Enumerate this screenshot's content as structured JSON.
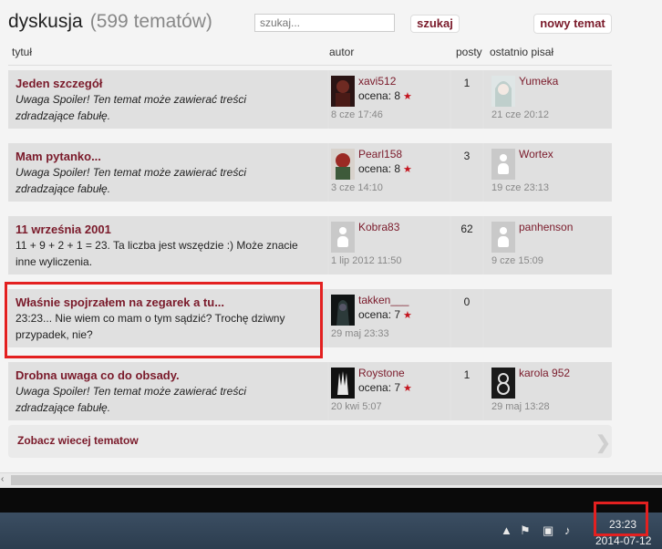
{
  "header": {
    "title": "dyskusja",
    "count": "(599 tematów)",
    "search_placeholder": "szukaj...",
    "search_button": "szukaj",
    "new_topic_button": "nowy temat"
  },
  "columns": {
    "title": "tytuł",
    "author": "autor",
    "posts": "posty",
    "last": "ostatnio pisał"
  },
  "topics": [
    {
      "title": "Jeden szczegół",
      "desc": "Uwaga Spoiler! Ten temat może zawierać treści zdradzające fabułę.",
      "author": "xavi512",
      "author_rating": "ocena: 8",
      "author_date": "8 cze 17:46",
      "posts": "1",
      "last_user": "Yumeka",
      "last_date": "21 cze 20:12"
    },
    {
      "title": "Mam pytanko...",
      "desc": "Uwaga Spoiler! Ten temat może zawierać treści zdradzające fabułę.",
      "author": "Pearl158",
      "author_rating": "ocena: 8",
      "author_date": "3 cze 14:10",
      "posts": "3",
      "last_user": "Wortex",
      "last_date": "19 cze 23:13"
    },
    {
      "title": "11 września 2001",
      "desc": "11 + 9 + 2 + 1 = 23. Ta liczba jest wszędzie :) Może znacie inne wyliczenia.",
      "author": "Kobra83",
      "author_date": "1 lip 2012 11:50",
      "posts": "62",
      "last_user": "panhenson",
      "last_date": "9 cze 15:09"
    },
    {
      "title": "Właśnie spojrzałem na zegarek a tu...",
      "desc": "23:23... Nie wiem co mam o tym sądzić? Trochę dziwny przypadek, nie?",
      "author": "takken___",
      "author_rating": "ocena: 7",
      "author_date": "29 maj 23:33",
      "posts": "0"
    },
    {
      "title": "Drobna uwaga co do obsady.",
      "desc": "Uwaga Spoiler! Ten temat może zawierać treści zdradzające fabułę.",
      "author": "Roystone",
      "author_rating": "ocena: 7",
      "author_date": "20 kwi 5:07",
      "posts": "1",
      "last_user": "karola  952",
      "last_date": "29 maj 13:28"
    }
  ],
  "more_label": "Zobacz wiecej tematow",
  "taskbar": {
    "time": "23:23",
    "date": "2014-07-12"
  },
  "icons": {
    "star": "star-icon",
    "arrow": "chevron-right-icon",
    "flag": "flag-icon",
    "network": "network-icon",
    "volume": "volume-icon",
    "tray_up": "tray-arrow-icon"
  },
  "colors": {
    "link": "#7a1a2a",
    "highlight": "#e32020",
    "taskbar": "#2c3d4f"
  }
}
